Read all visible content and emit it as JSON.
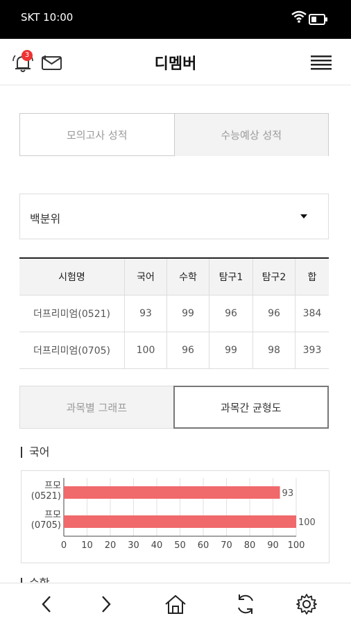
{
  "status_bar": {
    "carrier_time": "SKT  10:00",
    "battery_level": 0.45
  },
  "header": {
    "title": "디멤버",
    "notification_count": "3",
    "icons": [
      "bell-icon",
      "mail-icon",
      "hamburger-menu-icon"
    ]
  },
  "score_tabs": [
    {
      "label": "모의고사 성적",
      "selected": false
    },
    {
      "label": "수능예상 성적",
      "selected": true
    }
  ],
  "score_type_select": {
    "value": "백분위"
  },
  "table": {
    "headers": [
      "시험명",
      "국어",
      "수학",
      "탐구1",
      "탐구2",
      "합"
    ],
    "rows": [
      [
        "더프리미엄(0521)",
        "93",
        "99",
        "96",
        "96",
        "384"
      ],
      [
        "더프리미엄(0705)",
        "100",
        "96",
        "99",
        "98",
        "393"
      ]
    ]
  },
  "graph_tabs": [
    {
      "label": "과목별 그래프",
      "selected": false
    },
    {
      "label": "과목간 균형도",
      "selected": true
    }
  ],
  "section_label": "국어",
  "next_section_label": "수학",
  "colors": {
    "bar": "#f0696b",
    "grid": "#e2e2e2",
    "axis": "#444444"
  },
  "chart_data": {
    "type": "bar",
    "orientation": "horizontal",
    "categories": [
      "프모\n(0521)",
      "프모\n(0705)"
    ],
    "values": [
      93,
      100
    ],
    "xlim": [
      0,
      100
    ],
    "xticks": [
      0,
      10,
      20,
      30,
      40,
      50,
      60,
      70,
      80,
      90,
      100
    ],
    "grid": true
  },
  "bottom_nav": [
    "back-arrow-icon",
    "forward-arrow-icon",
    "home-icon",
    "refresh-icon",
    "settings-gear-icon"
  ]
}
